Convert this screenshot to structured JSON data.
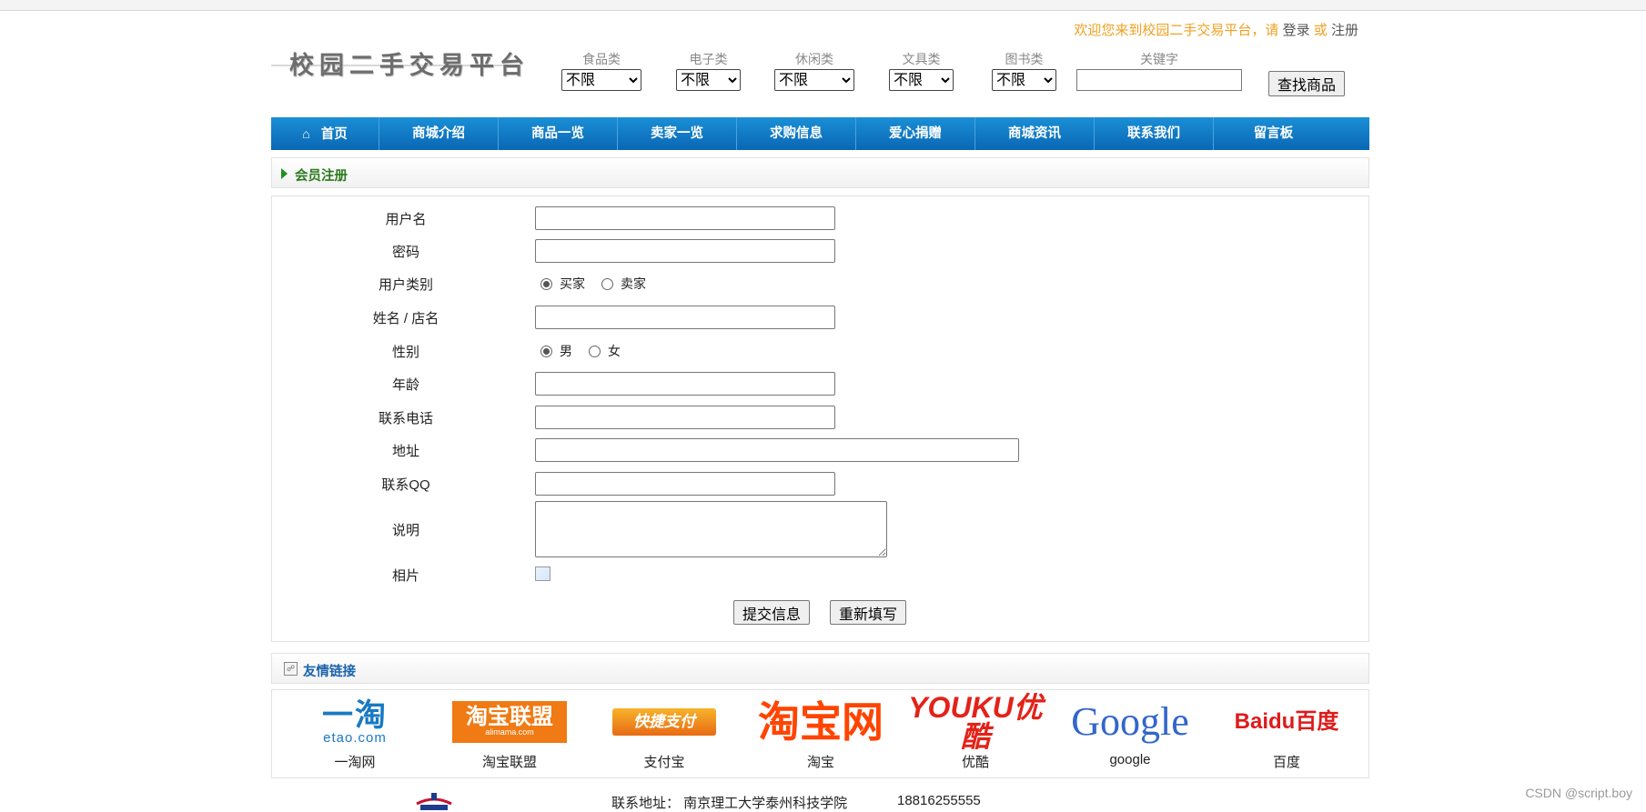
{
  "header": {
    "welcome_text": "欢迎您来到校园二手交易平台，请",
    "login": "登录",
    "or": "或",
    "register": "注册",
    "logo_text": "校园二手交易平台"
  },
  "filters": [
    {
      "label": "食品类",
      "value": "不限"
    },
    {
      "label": "电子类",
      "value": "不限"
    },
    {
      "label": "休闲类",
      "value": "不限"
    },
    {
      "label": "文具类",
      "value": "不限"
    },
    {
      "label": "图书类",
      "value": "不限"
    }
  ],
  "keyword": {
    "label": "关键字",
    "value": ""
  },
  "search_button": "查找商品",
  "nav": [
    "首页",
    "商城介绍",
    "商品一览",
    "卖家一览",
    "求购信息",
    "爱心捐赠",
    "商城资讯",
    "联系我们",
    "留言板"
  ],
  "register_section": {
    "title": "会员注册",
    "fields": {
      "username": "用户名",
      "password": "密码",
      "user_type": "用户类别",
      "user_type_options": [
        "买家",
        "卖家"
      ],
      "name_shop": "姓名 / 店名",
      "gender": "性别",
      "gender_options": [
        "男",
        "女"
      ],
      "age": "年龄",
      "phone": "联系电话",
      "address": "地址",
      "qq": "联系QQ",
      "description": "说明",
      "photo": "相片"
    },
    "submit": "提交信息",
    "reset": "重新填写"
  },
  "friends": {
    "title": "友情链接",
    "items": [
      {
        "name": "一淘网",
        "logo": "一淘",
        "sub": "etao.com",
        "color": "#1979c3"
      },
      {
        "name": "淘宝联盟",
        "logo": "淘宝联盟",
        "sub": "alimama.com",
        "color": "#f07a13"
      },
      {
        "name": "支付宝",
        "logo": "快捷支付",
        "sub": "",
        "color": "#e86a14"
      },
      {
        "name": "淘宝",
        "logo": "淘宝网",
        "sub": "",
        "color": "#ff4400"
      },
      {
        "name": "优酷",
        "logo": "YOUKU优酷",
        "sub": "",
        "color": "#e32219"
      },
      {
        "name": "google",
        "logo": "Google",
        "sub": "",
        "color": "#3366cc"
      },
      {
        "name": "百度",
        "logo": "Baidu百度",
        "sub": "",
        "color": "#de1b1b"
      }
    ]
  },
  "footer": {
    "address": "联系地址：  南京理工大学泰州科技学院",
    "phone": "18816255555"
  },
  "watermark": "CSDN @script.boy"
}
